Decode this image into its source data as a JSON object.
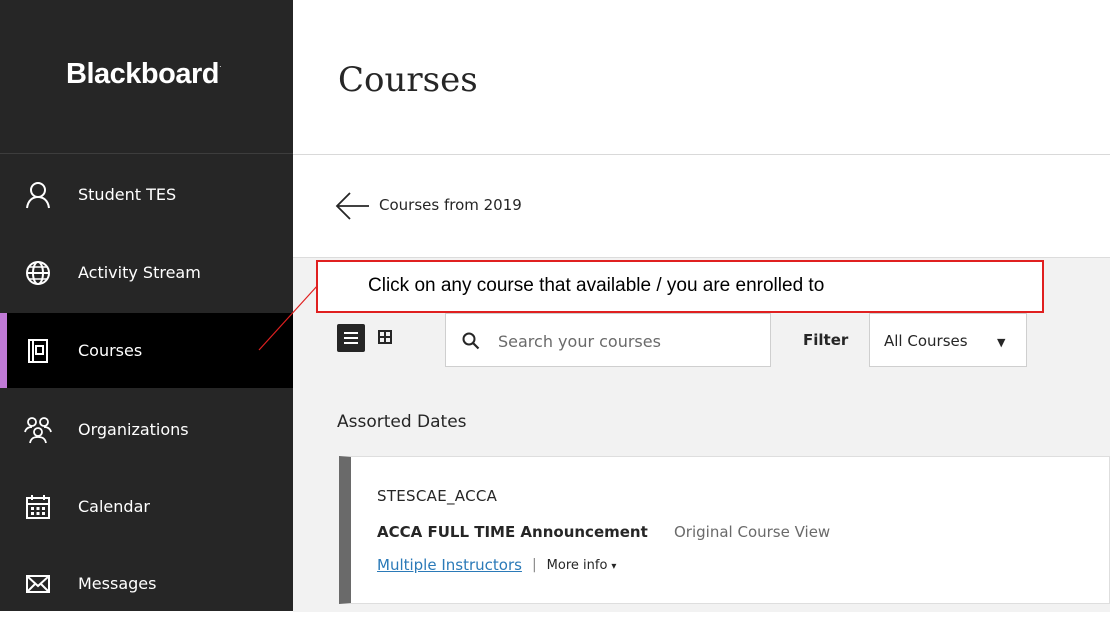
{
  "brand": {
    "logo": "Blackboard"
  },
  "sidebar": {
    "items": [
      {
        "label": "Student TES",
        "icon": "user-icon"
      },
      {
        "label": "Activity Stream",
        "icon": "globe-icon"
      },
      {
        "label": "Courses",
        "icon": "courses-icon",
        "active": true
      },
      {
        "label": "Organizations",
        "icon": "organizations-icon"
      },
      {
        "label": "Calendar",
        "icon": "calendar-icon"
      },
      {
        "label": "Messages",
        "icon": "envelope-icon"
      }
    ],
    "active_accent": "#c07ad6"
  },
  "main": {
    "title": "Courses",
    "back_label": "Courses from 2019",
    "search": {
      "placeholder": "Search your courses",
      "value": ""
    },
    "filter": {
      "label": "Filter",
      "value": "All Courses"
    },
    "section_heading": "Assorted Dates",
    "course": {
      "id": "STESCAE_ACCA",
      "name": "ACCA FULL TIME Announcement",
      "view": "Original Course View",
      "instructors": "Multiple Instructors",
      "separator": "|",
      "more_info": "More info"
    }
  },
  "annotation": {
    "text": "Click on any course that available / you are enrolled to",
    "color": "#e02020"
  }
}
